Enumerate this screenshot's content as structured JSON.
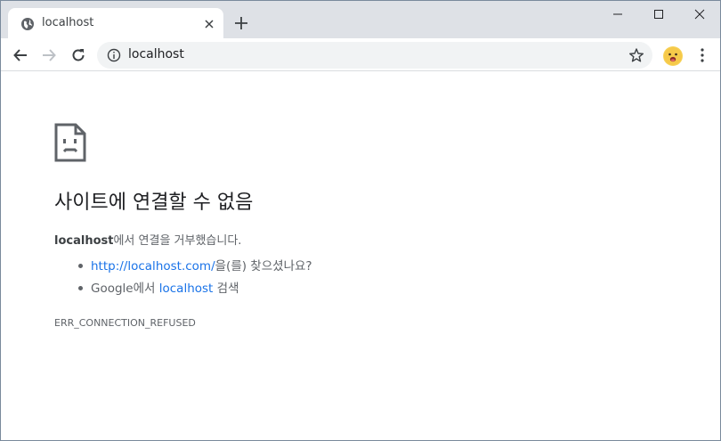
{
  "tab": {
    "title": "localhost",
    "favicon": "globe-icon",
    "close_icon": "close-icon"
  },
  "new_tab_icon": "plus-icon",
  "window_controls": [
    "minimize-icon",
    "maximize-icon",
    "close-icon"
  ],
  "toolbar": {
    "back_icon": "arrow-left-icon",
    "forward_icon": "arrow-right-icon",
    "reload_icon": "reload-icon",
    "address": "localhost",
    "info_icon": "info-icon",
    "bookmark_icon": "star-icon",
    "profile_icon": "emoji-avatar-icon",
    "menu_icon": "kebab-menu-icon"
  },
  "error": {
    "icon": "sad-page-icon",
    "title": "사이트에 연결할 수 없음",
    "host": "localhost",
    "description_suffix": "에서 연결을 거부했습니다.",
    "suggestions": {
      "first_link": "http://localhost.com/",
      "first_suffix": "을(를) 찾으셨나요?",
      "second_prefix": "Google에서 ",
      "second_link": "localhost",
      "second_suffix": " 검색"
    },
    "code": "ERR_CONNECTION_REFUSED"
  },
  "colors": {
    "tabstrip_bg": "#dee1e6",
    "omnibox_bg": "#f1f3f4",
    "link": "#1a73e8",
    "text_secondary": "#5f6368"
  }
}
